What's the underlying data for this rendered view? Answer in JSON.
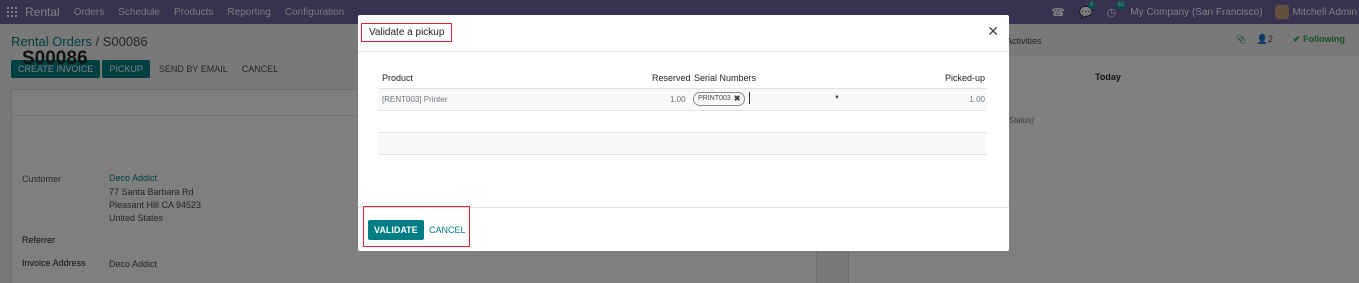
{
  "navbar": {
    "app_name": "Rental",
    "menu": [
      "Orders",
      "Schedule",
      "Products",
      "Reporting",
      "Configuration"
    ],
    "messages_count": "6",
    "activities_count": "62",
    "company": "My Company (San Francisco)",
    "user": "Mitchell Admin",
    "accent_color": "#71639e"
  },
  "control_panel": {
    "breadcrumb_parent": "Rental Orders",
    "breadcrumb_sep": " / ",
    "breadcrumb_current": "S00086",
    "buttons": {
      "create_invoice": "CREATE INVOICE",
      "pickup": "PICKUP",
      "send_by_email": "SEND BY EMAIL",
      "cancel": "CANCEL"
    }
  },
  "form": {
    "order_name": "S00086",
    "customer_label": "Customer",
    "customer_name": "Deco Addict",
    "customer_address": [
      "77 Santa Barbara Rd",
      "Pleasant Hill CA 94523",
      "United States"
    ],
    "referrer_label": "Referrer",
    "invoice_address_label": "Invoice Address",
    "invoice_address_value": "Deco Addict"
  },
  "chatter": {
    "activities_tab": "Activities",
    "followers_count": "2",
    "following_label": "Following",
    "today_label": "Today",
    "status_fragment": "(Status)"
  },
  "dialog": {
    "title": "Validate a pickup",
    "columns": {
      "product": "Product",
      "reserved": "Reserved",
      "serial_numbers": "Serial Numbers",
      "picked_up": "Picked-up"
    },
    "rows": [
      {
        "product": "[RENT003] Printer",
        "reserved": "1.00",
        "serial_tag": "PRINT003",
        "picked_up": "1.00"
      }
    ],
    "buttons": {
      "validate": "VALIDATE",
      "cancel": "CANCEL"
    },
    "primary_color": "#017e84"
  }
}
